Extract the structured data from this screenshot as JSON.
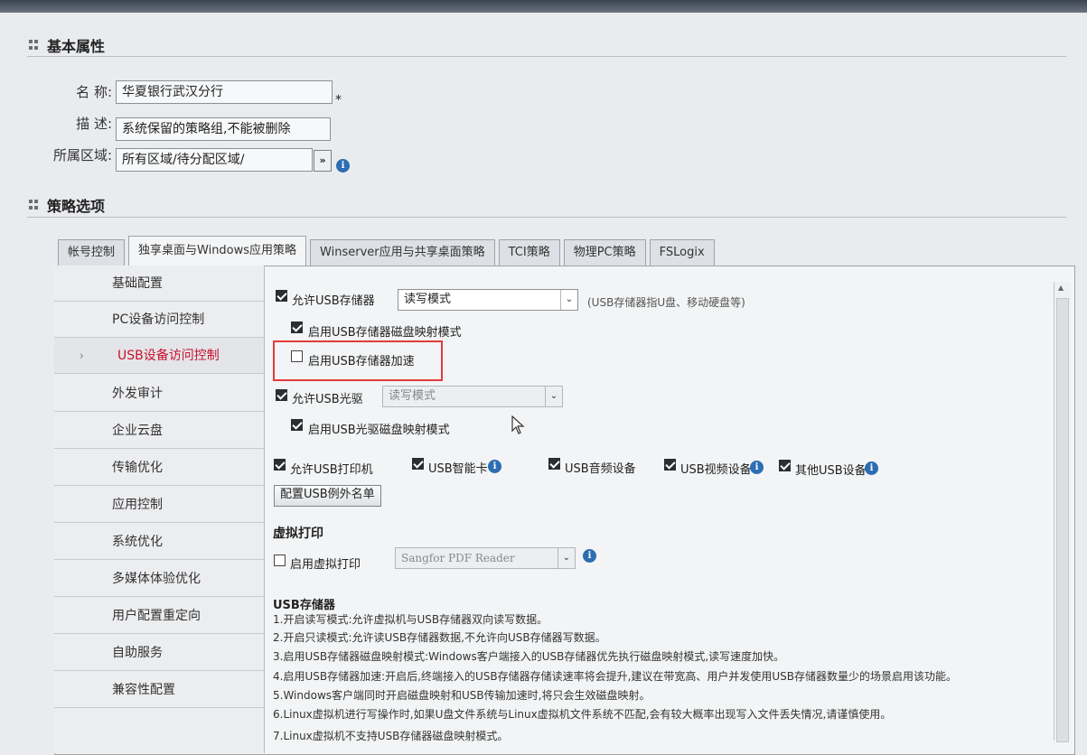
{
  "basic": {
    "section_title": "基本属性",
    "name_label": "名 称:",
    "name_value": "华夏银行武汉分行",
    "required_mark": "*",
    "desc_label": "描 述:",
    "desc_value": "系统保留的策略组,不能被删除",
    "region_label": "所属区域:",
    "region_value": "所有区域/待分配区域/",
    "region_button": "»"
  },
  "policy": {
    "section_title": "策略选项",
    "tabs": [
      {
        "label": "帐号控制"
      },
      {
        "label": "独享桌面与Windows应用策略"
      },
      {
        "label": "Winserver应用与共享桌面策略"
      },
      {
        "label": "TCI策略"
      },
      {
        "label": "物理PC策略"
      },
      {
        "label": "FSLogix"
      }
    ],
    "sidebar": [
      {
        "label": "基础配置"
      },
      {
        "label": "PC设备访问控制"
      },
      {
        "label": "USB设备访问控制"
      },
      {
        "label": "外发审计"
      },
      {
        "label": "企业云盘"
      },
      {
        "label": "传输优化"
      },
      {
        "label": "应用控制"
      },
      {
        "label": "系统优化"
      },
      {
        "label": "多媒体体验优化"
      },
      {
        "label": "用户配置重定向"
      },
      {
        "label": "自助服务"
      },
      {
        "label": "兼容性配置"
      }
    ],
    "active_chevron": "›"
  },
  "usb": {
    "allow_storage": {
      "label": "允许USB存储器",
      "checked": true
    },
    "storage_mode": "读写模式",
    "storage_hint": "(USB存储器指U盘、移动硬盘等)",
    "storage_mapping": {
      "label": "启用USB存储器磁盘映射模式",
      "checked": true
    },
    "storage_accel": {
      "label": "启用USB存储器加速",
      "checked": false
    },
    "allow_cdrom": {
      "label": "允许USB光驱",
      "checked": true
    },
    "cdrom_mode": "读写模式",
    "cdrom_mapping": {
      "label": "启用USB光驱磁盘映射模式",
      "checked": true
    },
    "printer": {
      "label": "允许USB打印机",
      "checked": true
    },
    "smartcard": {
      "label": "USB智能卡",
      "checked": true
    },
    "audio": {
      "label": "USB音频设备",
      "checked": true
    },
    "video": {
      "label": "USB视频设备",
      "checked": true
    },
    "other": {
      "label": "其他USB设备",
      "checked": true
    },
    "exception_button": "配置USB例外名单",
    "dropdown_arrow": "⌄"
  },
  "virtual_print": {
    "title": "虚拟打印",
    "enable": {
      "label": "启用虚拟打印",
      "checked": false
    },
    "printer_value": "Sangfor PDF Reader"
  },
  "help": {
    "title": "USB存储器",
    "lines": [
      "1.开启读写模式:允许虚拟机与USB存储器双向读写数据。",
      "2.开启只读模式:允许读USB存储器数据,不允许向USB存储器写数据。",
      "3.启用USB存储器磁盘映射模式:Windows客户端接入的USB存储器优先执行磁盘映射模式,读写速度加快。",
      "4.启用USB存储器加速:开启后,终端接入的USB存储器存储读速率将会提升,建议在带宽高、用户并发使用USB存储器数量少的场景启用该功能。",
      "5.Windows客户端同时开启磁盘映射和USB传输加速时,将只会生效磁盘映射。",
      "6.Linux虚拟机进行写操作时,如果U盘文件系统与Linux虚拟机文件系统不匹配,会有较大概率出现写入文件丢失情况,请谨慎使用。",
      "7.Linux虚拟机不支持USB存储器磁盘映射模式。"
    ]
  },
  "info_glyph": "i"
}
